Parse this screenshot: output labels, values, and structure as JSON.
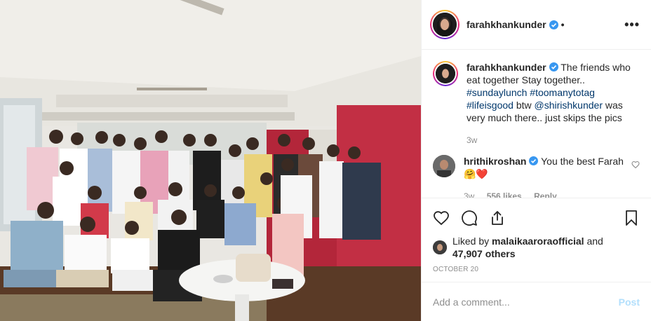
{
  "post": {
    "username": "farahkhankunder",
    "verified_icon": "verified-badge-icon",
    "separator": "•",
    "more_icon": "more-options-icon",
    "more_label": "•••",
    "caption": {
      "username": "farahkhankunder",
      "text_1": "The friends who eat together Stay together..",
      "hashtags_1": "#sundaylunch #toomanytotag",
      "hashtag_2": "#lifeisgood",
      "text_2": " btw ",
      "mention": "@shirishkunder",
      "text_3": " was very much there.. just skips the pics",
      "time": "3w"
    },
    "comment": {
      "username": "hrithikroshan",
      "text": "You the best Farah",
      "emoji": "🤗❤️",
      "time": "3w",
      "likes": "556 likes",
      "reply_label": "Reply"
    },
    "likes": {
      "prefix": "Liked by",
      "user": "malaikaaroraofficial",
      "and": "and",
      "others": "47,907 others"
    },
    "date": "OCTOBER 20",
    "add_comment": {
      "placeholder": "Add a comment...",
      "post_label": "Post"
    }
  },
  "colors": {
    "verified": "#3897f0",
    "link": "#00376b",
    "post_disabled": "#b2dffc",
    "secondary_text": "#8e8e8e"
  }
}
